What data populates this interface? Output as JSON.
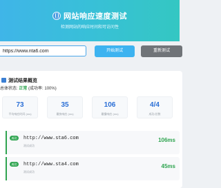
{
  "header": {
    "title": "网站响应速度测试",
    "subtitle": "检测网站的响应时间和可访问性",
    "globe_icon": "globe-icon"
  },
  "controls": {
    "url_value": "https://www.nta6.com",
    "start_label": "开始测试",
    "retest_label": "重新测试"
  },
  "summary": {
    "title": "测试结果概览",
    "overall_prefix": "总体状态:",
    "overall_status": "正常",
    "success_rate": "(成功率: 100%)",
    "stats": [
      {
        "value": "73",
        "label": "平均响应时间 (ms)"
      },
      {
        "value": "35",
        "label": "最快响应 (ms)"
      },
      {
        "value": "106",
        "label": "最慢响应 (ms)"
      },
      {
        "value": "4/4",
        "label": "成功/总数"
      }
    ]
  },
  "results": [
    {
      "badge": "成功",
      "url": "http://www.sta6.com",
      "status": "测试成功",
      "time": "106ms"
    },
    {
      "badge": "成功",
      "url": "http://www.sta4.com",
      "status": "测试成功",
      "time": "45ms"
    }
  ],
  "colors": {
    "accent_blue": "#3db3f0",
    "success_green": "#2ea44f",
    "stat_blue": "#2b6fd6"
  }
}
